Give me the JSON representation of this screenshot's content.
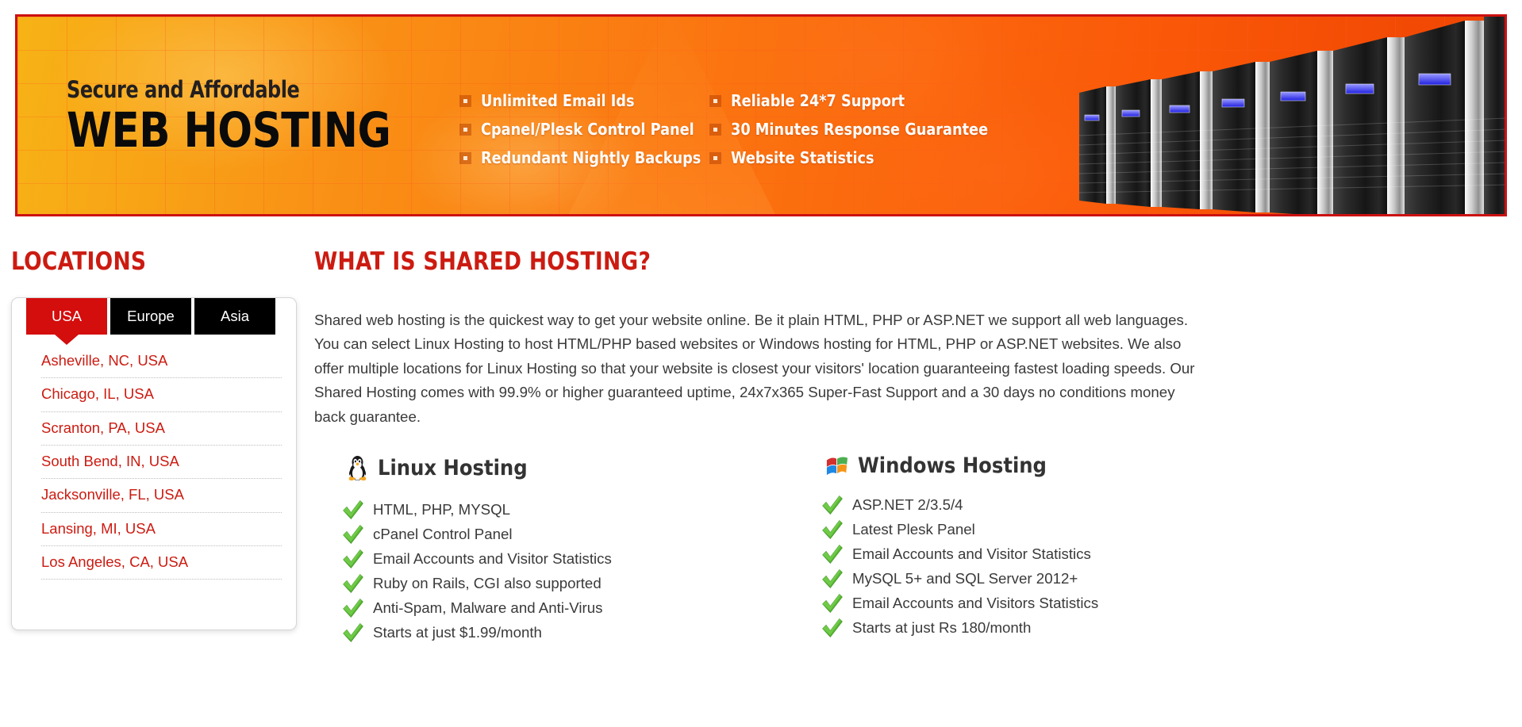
{
  "banner": {
    "subtitle": "Secure and Affordable",
    "title": "WEB HOSTING",
    "bullets_left": [
      "Unlimited Email Ids",
      "Cpanel/Plesk Control Panel",
      "Redundant Nightly Backups"
    ],
    "bullets_right": [
      "Reliable 24*7 Support",
      "30 Minutes Response Guarantee",
      "Website Statistics"
    ],
    "border_color": "#cc1111",
    "accent_color": "#f58220"
  },
  "sidebar": {
    "heading": "LOCATIONS",
    "tabs": [
      {
        "label": "USA",
        "active": true
      },
      {
        "label": "Europe",
        "active": false
      },
      {
        "label": "Asia",
        "active": false
      }
    ],
    "locations": [
      "Asheville, NC, USA",
      "Chicago, IL, USA",
      "Scranton, PA, USA",
      "South Bend, IN, USA",
      "Jacksonville, FL, USA",
      "Lansing, MI, USA",
      "Los Angeles, CA, USA"
    ],
    "link_color": "#cc1b11",
    "active_tab_color": "#d40d0d"
  },
  "main": {
    "heading": "WHAT IS SHARED HOSTING?",
    "paragraph": "Shared web hosting is the quickest way to get your website online. Be it plain HTML, PHP or ASP.NET we support all web languages. You can select Linux Hosting to host HTML/PHP based websites or Windows hosting for HTML, PHP or ASP.NET websites. We also offer multiple locations for Linux Hosting so that your website is closest your visitors' location guaranteeing fastest loading speeds. Our Shared Hosting comes with 99.9% or higher guaranteed uptime, 24x7x365 Super-Fast Support and a 30 days no conditions money back guarantee.",
    "plans": [
      {
        "icon": "tux-penguin-icon",
        "title": "Linux Hosting",
        "features": [
          "HTML, PHP, MYSQL",
          "cPanel Control Panel",
          "Email Accounts and Visitor Statistics",
          "Ruby on Rails, CGI also supported",
          "Anti-Spam, Malware and Anti-Virus",
          "Starts at just $1.99/month"
        ]
      },
      {
        "icon": "windows-flag-icon",
        "title": "Windows Hosting",
        "features": [
          "ASP.NET 2/3.5/4",
          "Latest Plesk Panel",
          "Email Accounts and Visitor Statistics",
          "MySQL 5+ and SQL Server 2012+",
          "Email Accounts and Visitors Statistics",
          "Starts at just Rs 180/month"
        ]
      }
    ],
    "heading_color": "#cc1b11",
    "text_color": "#3a3a3a",
    "tick_color": "#5cb82a"
  }
}
